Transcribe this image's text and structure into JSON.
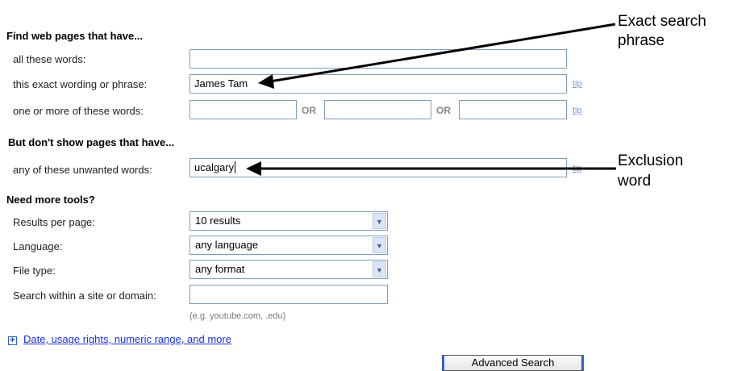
{
  "section_find": {
    "heading": "Find web pages that have...",
    "all_words_label": "all these words:",
    "all_words_value": "",
    "exact_label": "this exact wording or phrase:",
    "exact_value": "James Tam",
    "tip": "tip",
    "any_words_label": "one or more of these words:",
    "or_label": "OR",
    "any_words_values": [
      "",
      "",
      ""
    ]
  },
  "section_exclude": {
    "heading": "But don't show pages that have...",
    "unwanted_label": "any of these unwanted words:",
    "unwanted_value": "ucalgary",
    "tip": "tip"
  },
  "section_tools": {
    "heading": "Need more tools?",
    "results_label": "Results per page:",
    "results_value": "10 results",
    "language_label": "Language:",
    "language_value": "any language",
    "filetype_label": "File type:",
    "filetype_value": "any format",
    "site_label": "Search within a site or domain:",
    "site_value": "",
    "site_hint": "(e.g. youtube.com, .edu)"
  },
  "more_link": "Date, usage rights, numeric range, and more",
  "submit_label": "Advanced Search",
  "annotations": {
    "exact_line1": "Exact search",
    "exact_line2": "phrase",
    "exclusion_line1": "Exclusion",
    "exclusion_line2": "word"
  }
}
